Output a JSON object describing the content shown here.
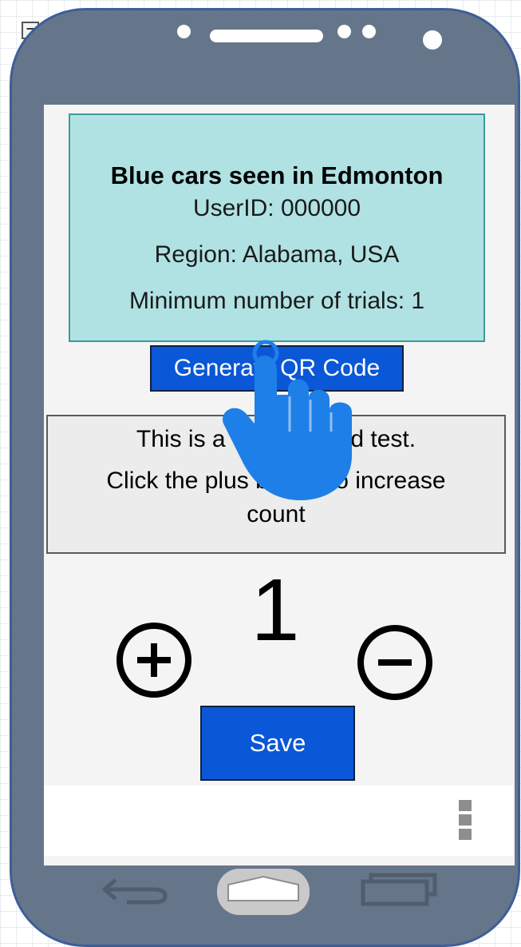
{
  "card": {
    "title": "Blue cars seen in Edmonton",
    "user_id": "UserID: 000000",
    "region": "Region: Alabama, USA",
    "min_trials": "Minimum number of trials: 1"
  },
  "qr_button_label": "Generate QR Code",
  "test_info": {
    "line1": "This is a count-based test.",
    "line2": "Click the plus button to increase",
    "line3": "count"
  },
  "counter": {
    "value": "1",
    "increment_icon": "plus-circle-icon",
    "decrement_icon": "minus-circle-icon"
  },
  "save_label": "Save",
  "nav": {
    "back_icon": "back-arrow-icon",
    "home_icon": "home-icon",
    "recent_icon": "recent-apps-icon",
    "overflow_icon": "overflow-menu-icon"
  },
  "overlay": {
    "icon": "tap-hand-icon",
    "color": "#1f7fe8"
  },
  "colors": {
    "card_bg": "#b0e2e4",
    "button_blue": "#0a57d7",
    "phone_body": "#66768a"
  }
}
